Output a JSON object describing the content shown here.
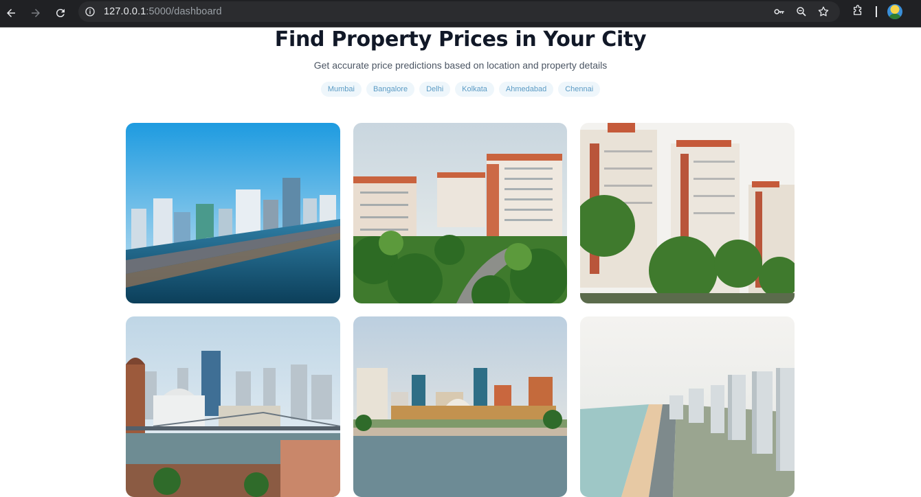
{
  "browser": {
    "url_host": "127.0.0.1",
    "url_path": ":5000/dashboard"
  },
  "page": {
    "title": "Find Property Prices in Your City",
    "subtitle": "Get accurate price predictions based on location and property details",
    "cities": [
      "Mumbai",
      "Bangalore",
      "Delhi",
      "Kolkata",
      "Ahmedabad",
      "Chennai"
    ]
  },
  "colors": {
    "chip_bg": "#eef6fb",
    "chip_text": "#5b9bc4",
    "title": "#111827"
  }
}
